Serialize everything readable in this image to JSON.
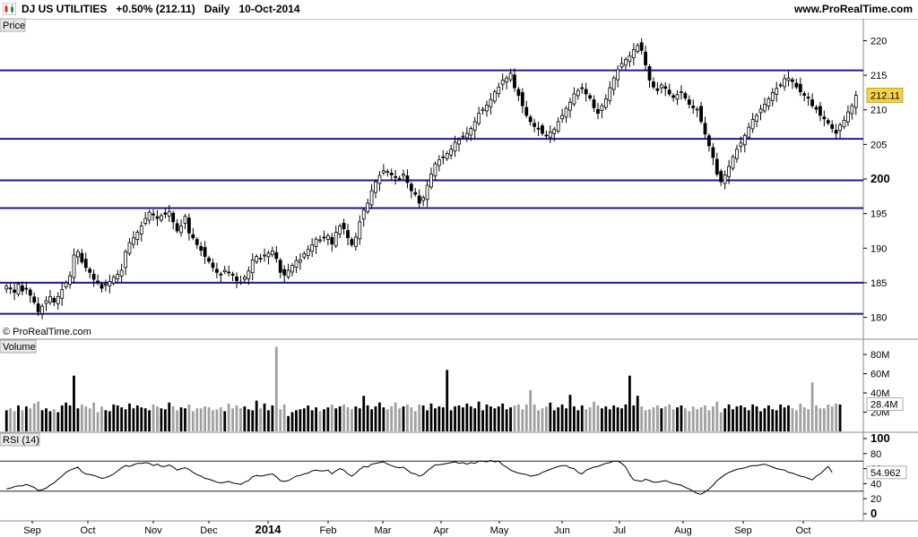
{
  "header": {
    "instrument": "DJ US UTILITIES",
    "change": "+0.50% (212.11)",
    "period": "Daily",
    "date": "10-Oct-2014",
    "website": "www.ProRealTime.com"
  },
  "panels": {
    "price_label": "Price",
    "volume_label": "Volume",
    "rsi_label": "RSI (14)",
    "watermark": "© ProRealTime.com"
  },
  "colors": {
    "hline": "#1a1a8c",
    "last_price_bg": "#f2d24a",
    "volume_up": "#000000",
    "volume_down": "#a0a0a0",
    "rsi_line": "#000000",
    "grid": "#d8d8d8"
  },
  "chart_data": [
    {
      "type": "candlestick",
      "panel": "price",
      "ylim": [
        178,
        222
      ],
      "yticks": [
        180,
        185,
        190,
        195,
        200,
        205,
        210,
        215,
        220
      ],
      "last_value": "212.11",
      "xticks": [
        "Sep",
        "Oct",
        "Nov",
        "Dec",
        "2014",
        "Feb",
        "Mar",
        "Apr",
        "May",
        "Jun",
        "Jul",
        "Aug",
        "Sep",
        "Oct"
      ],
      "horizontal_levels": [
        215.7,
        205.8,
        199.8,
        195.8,
        185,
        180.5
      ],
      "series": [
        {
          "close": [
            184.5,
            184.2,
            183.6,
            184.8,
            183.8,
            184.2,
            183.2,
            182.2,
            180.8,
            181.6,
            182.4,
            183,
            182.2,
            183,
            184,
            185,
            186,
            189,
            189.5,
            188,
            187.2,
            186.5,
            185.5,
            185,
            184.2,
            184.8,
            185.2,
            185.8,
            186.2,
            186.8,
            189.5,
            190.8,
            191.5,
            192.3,
            193.2,
            194.3,
            195.2,
            194.8,
            194.3,
            194.7,
            194.9,
            195.3,
            193.8,
            192.5,
            193.2,
            194.6,
            192.2,
            191.5,
            190.5,
            189.7,
            188.8,
            188.1,
            187.2,
            186.5,
            186.2,
            186.8,
            186.5,
            186.1,
            185.3,
            185.1,
            185.8,
            186.7,
            188.3,
            188.8,
            188.5,
            189,
            189.3,
            189.6,
            188.5,
            186.5,
            186.1,
            186.8,
            187.5,
            188.2,
            188.3,
            189.2,
            189.8,
            190.5,
            191.3,
            191.2,
            191.5,
            191.8,
            190.6,
            192.3,
            193.2,
            192.8,
            191.5,
            190.5,
            191.6,
            193.8,
            195.5,
            196.5,
            198.3,
            199.6,
            200.5,
            201.2,
            201.1,
            200.6,
            200.3,
            200.1,
            200.7,
            199.5,
            198.3,
            197.8,
            196.5,
            197.3,
            199.1,
            200.7,
            202.2,
            202.8,
            203.2,
            203.7,
            204.3,
            205.3,
            205.7,
            206.2,
            206.6,
            207.3,
            208.3,
            209.5,
            210.1,
            210.7,
            211.5,
            212.6,
            213.3,
            214.3,
            214.6,
            215.3,
            213.2,
            212.1,
            210.6,
            209.2,
            208.3,
            207.6,
            207.3,
            206.6,
            206.3,
            206.8,
            207.2,
            208.3,
            209.2,
            210.2,
            211.1,
            212.3,
            212.8,
            213.2,
            212.3,
            211.7,
            210.3,
            209.5,
            210.6,
            211.6,
            213.2,
            214.6,
            215.8,
            216.7,
            217.3,
            217.8,
            218.7,
            219.3,
            218.6,
            216.5,
            214.3,
            213.3,
            212.8,
            213.6,
            213.1,
            212.3,
            211.8,
            212.2,
            212.6,
            211.7,
            210.8,
            210.3,
            210.1,
            208.3,
            206.5,
            204.8,
            203.1,
            200.7,
            199.6,
            200.6,
            201.8,
            203.2,
            204.3,
            205.2,
            206.3,
            207.5,
            208.6,
            209.2,
            210.1,
            210.8,
            211.6,
            212.5,
            213.1,
            213.6,
            214.5,
            214.6,
            214.1,
            213.3,
            212.6,
            212.1,
            211.7,
            210.6,
            210.1,
            209.2,
            208.7,
            208.1,
            207.3,
            206.6,
            207.8,
            208.5,
            209.7,
            210.6,
            212.1
          ]
        }
      ]
    },
    {
      "type": "bar",
      "panel": "volume",
      "ylim": [
        0,
        95
      ],
      "yticks": [
        20,
        40,
        60,
        80
      ],
      "ytick_labels": [
        "20M",
        "40M",
        "60M",
        "80M"
      ],
      "last_value": "28.4M",
      "unit": "M",
      "series": [
        {
          "values": [
            22,
            24,
            21,
            27,
            22,
            26,
            24,
            29,
            31,
            22,
            24,
            21,
            23,
            20,
            27,
            30,
            27,
            58,
            24,
            28,
            26,
            24,
            30,
            20,
            26,
            22,
            21,
            28,
            27,
            25,
            23,
            29,
            24,
            27,
            25,
            24,
            22,
            28,
            26,
            24,
            23,
            30,
            26,
            22,
            25,
            24,
            28,
            21,
            24,
            24,
            26,
            25,
            22,
            23,
            25,
            21,
            29,
            24,
            27,
            24,
            26,
            23,
            22,
            32,
            24,
            29,
            22,
            27,
            88,
            23,
            28,
            16,
            20,
            22,
            23,
            24,
            27,
            22,
            25,
            21,
            23,
            25,
            28,
            24,
            26,
            28,
            25,
            23,
            26,
            24,
            37,
            27,
            23,
            26,
            30,
            25,
            23,
            26,
            30,
            24,
            26,
            28,
            25,
            21,
            28,
            27,
            22,
            29,
            24,
            26,
            25,
            64,
            22,
            26,
            27,
            25,
            29,
            26,
            24,
            31,
            22,
            28,
            26,
            24,
            26,
            29,
            23,
            25,
            27,
            28,
            23,
            28,
            43,
            28,
            22,
            24,
            26,
            30,
            22,
            25,
            28,
            24,
            38,
            26,
            22,
            27,
            23,
            25,
            31,
            27,
            24,
            26,
            23,
            27,
            25,
            24,
            28,
            58,
            27,
            37,
            26,
            22,
            23,
            25,
            27,
            24,
            26,
            28,
            23,
            25,
            27,
            24,
            21,
            26,
            23,
            25,
            27,
            22,
            26,
            31,
            20,
            24,
            28,
            23,
            26,
            27,
            25,
            22,
            28,
            26,
            21,
            24,
            27,
            23,
            22,
            28,
            25,
            27,
            24,
            22,
            29,
            25,
            23,
            51,
            27,
            24,
            24,
            28,
            26,
            29,
            28
          ]
        }
      ]
    },
    {
      "type": "line",
      "panel": "rsi",
      "ylim": [
        0,
        100
      ],
      "yticks": [
        0,
        20,
        40,
        60,
        80,
        100
      ],
      "levels": [
        30,
        70
      ],
      "last_value": "54.962",
      "series": [
        {
          "values": [
            33,
            34,
            36,
            37,
            37,
            39,
            37,
            35,
            31,
            32,
            34,
            38,
            41,
            46,
            50,
            55,
            58,
            60,
            62,
            56,
            53,
            52,
            51,
            49,
            47,
            48,
            50,
            53,
            57,
            61,
            64,
            63,
            65,
            67,
            67,
            68,
            67,
            64,
            66,
            63,
            63,
            65,
            62,
            58,
            60,
            61,
            59,
            55,
            52,
            50,
            47,
            46,
            44,
            42,
            41,
            42,
            43,
            41,
            40,
            39,
            42,
            44,
            49,
            51,
            50,
            51,
            52,
            53,
            49,
            44,
            43,
            44,
            47,
            50,
            51,
            53,
            54,
            57,
            58,
            57,
            57,
            58,
            53,
            57,
            60,
            58,
            53,
            50,
            54,
            59,
            63,
            62,
            66,
            67,
            68,
            69,
            66,
            64,
            62,
            61,
            62,
            58,
            54,
            53,
            50,
            52,
            57,
            61,
            65,
            65,
            66,
            67,
            68,
            69,
            67,
            68,
            66,
            68,
            67,
            70,
            70,
            69,
            71,
            69,
            70,
            65,
            62,
            58,
            56,
            54,
            53,
            52,
            50,
            51,
            52,
            55,
            57,
            59,
            61,
            63,
            64,
            64,
            61,
            60,
            55,
            53,
            58,
            60,
            62,
            63,
            65,
            67,
            68,
            70,
            70,
            67,
            62,
            52,
            45,
            44,
            43,
            46,
            44,
            42,
            42,
            43,
            44,
            42,
            40,
            39,
            38,
            35,
            33,
            30,
            27,
            26,
            29,
            33,
            38,
            44,
            48,
            52,
            55,
            57,
            59,
            60,
            61,
            63,
            64,
            64,
            65,
            66,
            64,
            62,
            60,
            59,
            58,
            55,
            54,
            52,
            50,
            49,
            47,
            45,
            50,
            53,
            58,
            63,
            55
          ]
        }
      ]
    }
  ]
}
